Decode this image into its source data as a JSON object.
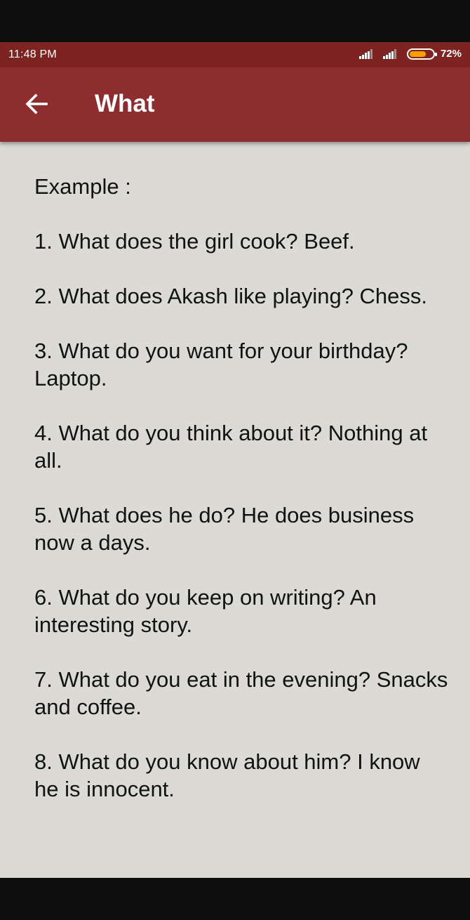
{
  "status_bar": {
    "time": "11:48 PM",
    "battery_percent": "72%",
    "battery_level": 0.72,
    "battery_color": "#f5a000"
  },
  "app_bar": {
    "back_icon": "arrow-left-icon",
    "title": "What",
    "color": "#8d2d2f"
  },
  "content": {
    "text": "Example :\n\n1. What does the girl cook? Beef.\n\n2. What does Akash like playing? Chess.\n\n3. What do you want for your birthday? Laptop.\n\n4. What do you think about it? Nothing at all.\n\n5. What does he do? He does business now a days.\n\n6. What do you keep on writing? An interesting story.\n\n7. What do you eat in the evening? Snacks and coffee.\n\n8. What do you know about him? I know he is innocent."
  }
}
